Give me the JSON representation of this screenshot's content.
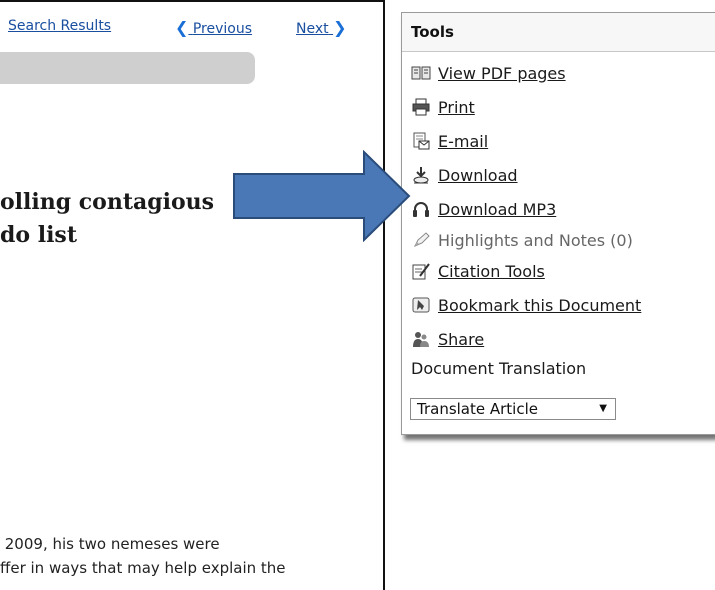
{
  "nav": {
    "search_results": "Search Results",
    "previous": "Previous",
    "next": "Next"
  },
  "article": {
    "title": "olling contagious\ndo list",
    "body": " 2009, his two nemeses were\nffer in ways that may help explain the"
  },
  "tools": {
    "header": "Tools",
    "items": [
      {
        "label": "View PDF pages",
        "icon": "book-icon",
        "enabled": true
      },
      {
        "label": "Print",
        "icon": "printer-icon",
        "enabled": true
      },
      {
        "label": "E-mail",
        "icon": "email-icon",
        "enabled": true
      },
      {
        "label": "Download",
        "icon": "download-icon",
        "enabled": true
      },
      {
        "label": "Download MP3",
        "icon": "headphones-icon",
        "enabled": true
      },
      {
        "label": "Highlights and Notes (0)",
        "icon": "highlighter-icon",
        "enabled": false
      },
      {
        "label": "Citation Tools",
        "icon": "citation-icon",
        "enabled": true
      },
      {
        "label": "Bookmark this Document",
        "icon": "bookmark-icon",
        "enabled": true
      },
      {
        "label": "Share",
        "icon": "share-icon",
        "enabled": true
      }
    ],
    "translation_heading": "Document Translation",
    "translate_select": "Translate Article"
  },
  "colors": {
    "link": "#1a4fa0",
    "chevron": "#1a6fd6",
    "arrow_fill": "#4a78b6",
    "arrow_stroke": "#2a4c7a"
  }
}
